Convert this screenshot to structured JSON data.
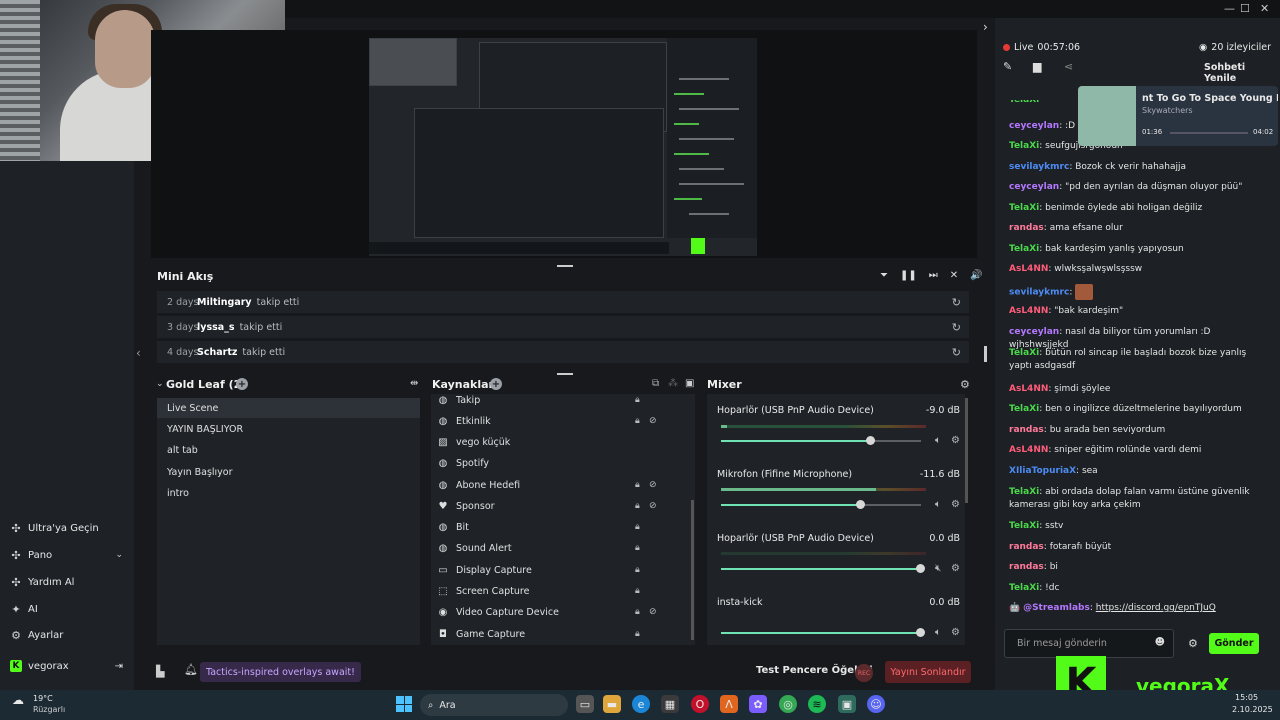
{
  "sidebar": {
    "items": [
      {
        "label": "Ultra'ya Geçin",
        "icon": "puzzle-icon"
      },
      {
        "label": "Pano",
        "icon": "puzzle-icon"
      },
      {
        "label": "Yardım Al",
        "icon": "puzzle-icon"
      },
      {
        "label": "AI",
        "icon": "sparkle-icon"
      },
      {
        "label": "Ayarlar",
        "icon": "gear-icon"
      }
    ],
    "user": "vegorax"
  },
  "mini_akis": {
    "title": "Mini Akış",
    "rows": [
      {
        "age": "2 days",
        "user": "Miltingary",
        "action": "takip etti"
      },
      {
        "age": "3 days",
        "user": "lyssa_s",
        "action": "takip etti"
      },
      {
        "age": "4 days",
        "user": "Schartz",
        "action": "takip etti"
      }
    ]
  },
  "scenes": {
    "title": "Gold Leaf (2)",
    "items": [
      "Live Scene",
      "YAYIN BAŞLIYOR",
      "alt tab",
      "Yayın Başlıyor",
      "intro"
    ]
  },
  "sources": {
    "title": "Kaynaklar",
    "items": [
      {
        "label": "Takip",
        "icon": "globe-icon"
      },
      {
        "label": "Etkinlik",
        "icon": "globe-icon"
      },
      {
        "label": "vego küçük",
        "icon": "image-icon"
      },
      {
        "label": "Spotify",
        "icon": "globe-icon"
      },
      {
        "label": "Abone Hedefi",
        "icon": "globe-icon"
      },
      {
        "label": "Sponsor",
        "icon": "heart-icon"
      },
      {
        "label": "Bit",
        "icon": "globe-icon"
      },
      {
        "label": "Sound Alert",
        "icon": "globe-icon"
      },
      {
        "label": "Display Capture",
        "icon": "monitor-icon"
      },
      {
        "label": "Screen Capture",
        "icon": "crop-icon"
      },
      {
        "label": "Video Capture Device",
        "icon": "webcam-icon"
      },
      {
        "label": "Game Capture",
        "icon": "gamepad-icon"
      }
    ]
  },
  "mixer": {
    "title": "Mixer",
    "channels": [
      {
        "name": "Hoparlör (USB PnP Audio Device)",
        "db": "-9.0 dB",
        "level": 0.75
      },
      {
        "name": "Mikrofon (Fifine Microphone)",
        "db": "-11.6 dB",
        "level": 0.7
      },
      {
        "name": "Hoparlör (USB PnP Audio Device)",
        "db": "0.0 dB",
        "level": 1.0
      },
      {
        "name": "insta-kick",
        "db": "0.0 dB",
        "level": 1.0
      }
    ]
  },
  "bottom": {
    "promo": "Tactics-inspired overlays await!",
    "test": "Test Pencere Öğeleri",
    "rec": "REC",
    "end_stream": "Yayını Sonlandır"
  },
  "stream_status": {
    "live": "Live",
    "time": "00:57:06",
    "viewers": "20 izleyiciler",
    "refresh": "Sohbeti Yenile"
  },
  "now_playing": {
    "title": "nt To Go To Space Young Mar",
    "artist": "Skywatchers",
    "elapsed": "01:36",
    "total": "04:02"
  },
  "chat": {
    "partial": "TelaXi",
    "messages": [
      {
        "user": "ceyceylan",
        "color": "#b378ff",
        "text": ":D"
      },
      {
        "user": "TelaXi",
        "color": "#4bd94b",
        "text": "seufgujisrgohouh"
      },
      {
        "user": "sevilaykmrc",
        "color": "#4d8cf5",
        "text": "Bozok ck verir hahahajja"
      },
      {
        "user": "ceyceylan",
        "color": "#b378ff",
        "text": "\"pd den ayrılan da düşman oluyor püü\""
      },
      {
        "user": "TelaXi",
        "color": "#4bd94b",
        "text": "benimde öylede abi holigan değiliz"
      },
      {
        "user": "randas",
        "color": "#ff7a9a",
        "text": "ama efsane olur"
      },
      {
        "user": "TelaXi",
        "color": "#4bd94b",
        "text": "bak kardeşim yanlış yapıyosun"
      },
      {
        "user": "AsL4NN",
        "color": "#ff5c7a",
        "text": "wlwksşalwşwlsşssw"
      },
      {
        "user": "sevilaykmrc",
        "color": "#4d8cf5",
        "text": ""
      },
      {
        "user": "AsL4NN",
        "color": "#ff5c7a",
        "text": "\"bak kardeşim\""
      },
      {
        "user": "ceyceylan",
        "color": "#b378ff",
        "text": "nasıl da biliyor tüm yorumları :D wjhshwsjjekd"
      },
      {
        "user": "TelaXi",
        "color": "#4bd94b",
        "text": "bütün rol sincap ile başladı bozok bize yanlış yaptı asdgasdf"
      },
      {
        "user": "AsL4NN",
        "color": "#ff5c7a",
        "text": "şimdi şöylee"
      },
      {
        "user": "TelaXi",
        "color": "#4bd94b",
        "text": "ben o ingilizce düzeltmelerine bayılıyordum"
      },
      {
        "user": "randas",
        "color": "#ff7a9a",
        "text": "bu arada ben seviyordum"
      },
      {
        "user": "AsL4NN",
        "color": "#ff5c7a",
        "text": "sniper eğitim rolünde vardı demi"
      },
      {
        "user": "XIliaTopuriaX",
        "color": "#4d8cf5",
        "text": "sea"
      },
      {
        "user": "TelaXi",
        "color": "#4bd94b",
        "text": "abi ordada dolap falan varmı üstüne güvenlik kamerası gibi koy arka çekim"
      },
      {
        "user": "TelaXi",
        "color": "#4bd94b",
        "text": "sstv"
      },
      {
        "user": "randas",
        "color": "#ff7a9a",
        "text": "fotarafı büyüt"
      },
      {
        "user": "randas",
        "color": "#ff7a9a",
        "text": "bi"
      },
      {
        "user": "TelaXi",
        "color": "#4bd94b",
        "text": "!dc"
      },
      {
        "user": "@Streamlabs",
        "color": "#b378ff",
        "text": "https://discord.gg/epnTJuQ"
      }
    ],
    "input_placeholder": "Bir mesaj gönderin",
    "send": "Gönder"
  },
  "overlay": {
    "brand": "vegoraX"
  },
  "taskbar": {
    "weather_temp": "19°C",
    "weather_desc": "Rüzgarlı",
    "search": "Ara",
    "time": "15:05",
    "date": "2.10.2025"
  }
}
